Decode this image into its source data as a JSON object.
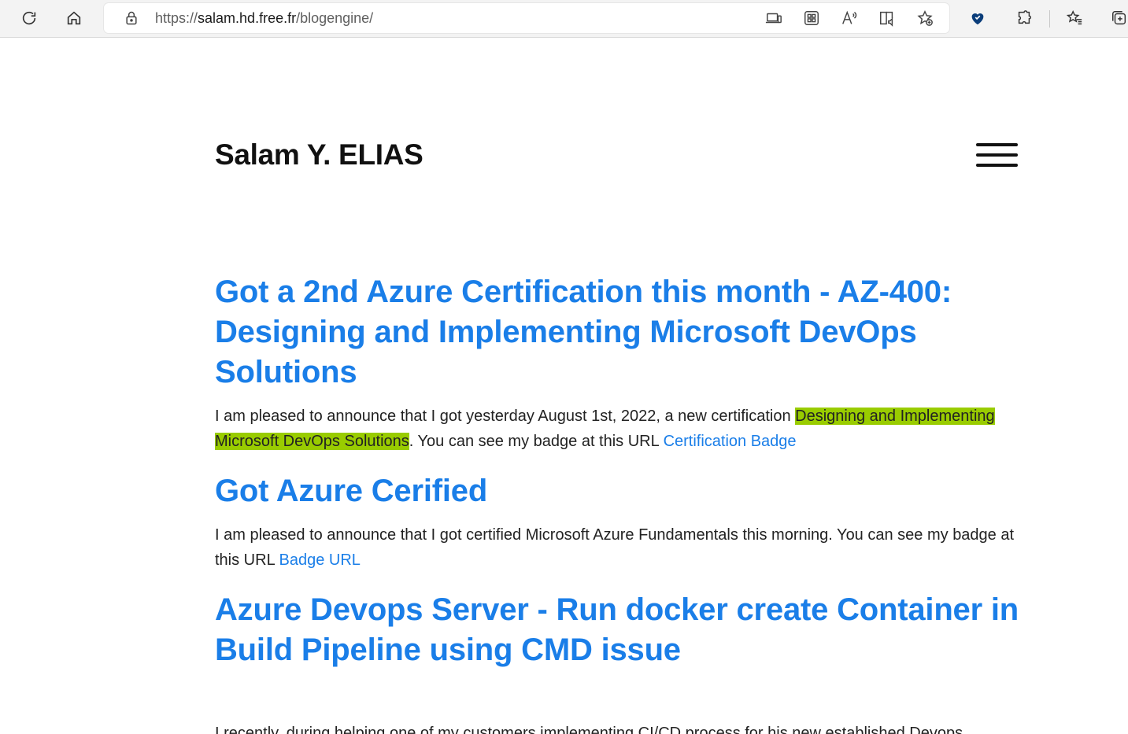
{
  "browser": {
    "url_prefix": "https://",
    "url_host": "salam.hd.free.fr",
    "url_path": "/blogengine/"
  },
  "site": {
    "title": "Salam Y. ELIAS"
  },
  "posts": [
    {
      "title": "Got a 2nd Azure Certification this month - AZ-400: Designing and Implementing Microsoft DevOps Solutions",
      "text_before": "I am pleased to announce that I got yesterday August 1st, 2022, a new certification  ",
      "highlight": "Designing and Implementing Microsoft DevOps Solutions",
      "text_after": ". You can see my badge at this URL ",
      "link": "Certification Badge"
    },
    {
      "title": "Got Azure Cerified",
      "text_before": "I am pleased to announce that I got certified  Microsoft Azure Fundamentals this morning. You can see my badge at this URL ",
      "link": "Badge URL"
    },
    {
      "title": "Azure Devops Server - Run docker create Container in Build Pipeline using CMD issue",
      "text_before": "I recently, during helping one of my customers implementing CI/CD process for his new established Devops"
    }
  ],
  "colors": {
    "link": "#1a7ee8",
    "highlight": "#99cc00"
  },
  "icons": [
    "refresh-icon",
    "home-icon",
    "lock-icon",
    "app-available-icon",
    "grid-icon",
    "read-aloud-icon",
    "immersive-reader-icon",
    "add-favorite-icon",
    "heart-shield-icon",
    "extensions-icon",
    "favorites-icon",
    "collections-icon"
  ]
}
